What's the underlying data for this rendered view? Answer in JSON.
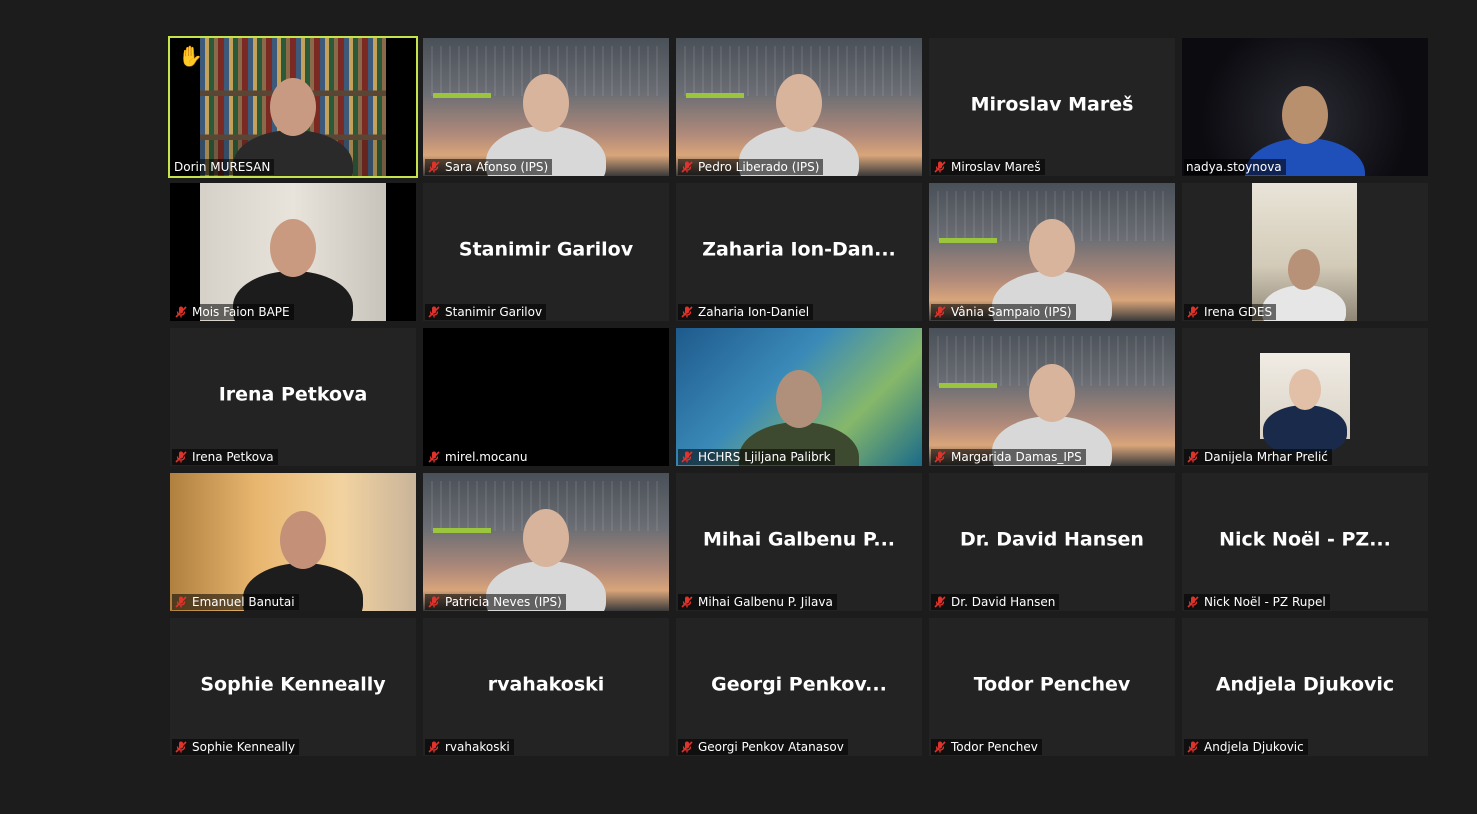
{
  "gallery": {
    "participants": [
      {
        "label": "Dorin MURESAN",
        "display_name": "",
        "video": "bookshelf",
        "muted": false,
        "raised_hand": true,
        "active_speaker": true
      },
      {
        "label": "Sara Afonso (IPS)",
        "display_name": "",
        "video": "ips",
        "muted": true
      },
      {
        "label": "Pedro Liberado (IPS)",
        "display_name": "",
        "video": "ips",
        "muted": true
      },
      {
        "label": "Miroslav Mareš",
        "display_name": "Miroslav Mareš",
        "video": "none",
        "muted": true
      },
      {
        "label": "nadya.stoynova",
        "display_name": "",
        "video": "dark-room",
        "muted": false
      },
      {
        "label": "Mois Faion BAPE",
        "display_name": "",
        "video": "wall",
        "muted": true
      },
      {
        "label": "Stanimir Garilov",
        "display_name": "Stanimir Garilov",
        "video": "none",
        "muted": true
      },
      {
        "label": "Zaharia Ion-Daniel",
        "display_name": "Zaharia Ion-Dan...",
        "video": "none",
        "muted": true
      },
      {
        "label": "Vânia Sampaio (IPS)",
        "display_name": "",
        "video": "ips",
        "muted": true
      },
      {
        "label": "Irena GDES",
        "display_name": "",
        "video": "kitchen",
        "muted": true
      },
      {
        "label": "Irena Petkova",
        "display_name": "Irena Petkova",
        "video": "none",
        "muted": true
      },
      {
        "label": "mirel.mocanu",
        "display_name": "",
        "video": "black",
        "muted": true
      },
      {
        "label": "HCHRS Ljiljana Palibrk",
        "display_name": "",
        "video": "blueworld",
        "muted": true
      },
      {
        "label": "Margarida Damas_IPS",
        "display_name": "",
        "video": "ips",
        "muted": true
      },
      {
        "label": "Danijela Mrhar Prelić",
        "display_name": "",
        "video": "portrait",
        "muted": true
      },
      {
        "label": "Emanuel Banutai",
        "display_name": "",
        "video": "warm",
        "muted": true
      },
      {
        "label": "Patricia Neves (IPS)",
        "display_name": "",
        "video": "ips",
        "muted": true
      },
      {
        "label": "Mihai Galbenu P. Jilava",
        "display_name": "Mihai Galbenu P...",
        "video": "none",
        "muted": true
      },
      {
        "label": "Dr. David Hansen",
        "display_name": "Dr. David Hansen",
        "video": "none",
        "muted": true
      },
      {
        "label": "Nick Noël - PZ Rupel",
        "display_name": "Nick Noël - PZ...",
        "video": "none",
        "muted": true
      },
      {
        "label": "Sophie Kenneally",
        "display_name": "Sophie Kenneally",
        "video": "none",
        "muted": true
      },
      {
        "label": "rvahakoski",
        "display_name": "rvahakoski",
        "video": "none",
        "muted": true
      },
      {
        "label": "Georgi Penkov Atanasov",
        "display_name": "Georgi Penkov...",
        "video": "none",
        "muted": true
      },
      {
        "label": "Todor Penchev",
        "display_name": "Todor Penchev",
        "video": "none",
        "muted": true
      },
      {
        "label": "Andjela Djukovic",
        "display_name": "Andjela Djukovic",
        "video": "none",
        "muted": true
      }
    ]
  },
  "colors": {
    "background": "#1c1c1c",
    "tile": "#232323",
    "active_speaker_outline": "#c5e34a",
    "muted_icon": "#e0332c"
  },
  "icons": {
    "muted": "mic-muted-icon",
    "raised_hand": "raise-hand-icon"
  }
}
